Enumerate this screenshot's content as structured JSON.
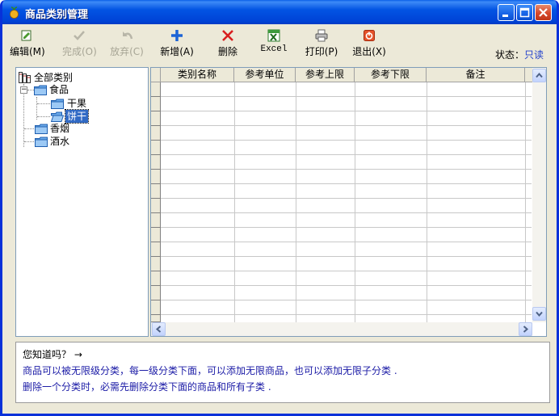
{
  "window": {
    "title": "商品类别管理"
  },
  "toolbar": {
    "edit": "编辑(M)",
    "done": "完成(O)",
    "discard": "放弃(C)",
    "add": "新增(A)",
    "delete": "删除",
    "excel": "Excel",
    "print": "打印(P)",
    "exit": "退出(X)"
  },
  "status": {
    "label": "状态：",
    "value": "只读"
  },
  "tree": {
    "root": "全部类别",
    "food": "食品",
    "dried_fruit": "干果",
    "biscuit": "饼干",
    "tobacco": "香烟",
    "liquor": "酒水"
  },
  "grid": {
    "columns": [
      "类别名称",
      "参考单位",
      "参考上限",
      "参考下限",
      "备注"
    ]
  },
  "tips": {
    "title": "您知道吗？ →",
    "line1": "商品可以被无限级分类，每一级分类下面，可以添加无限商品，也可以添加无限子分类 .",
    "line2": "删除一个分类时，必需先删除分类下面的商品和所有子类 ."
  },
  "colors": {
    "title_bar": "#0054e3",
    "selection": "#316ac5",
    "status_value": "#1f3fcc",
    "tip_text": "#1a1aa6"
  }
}
